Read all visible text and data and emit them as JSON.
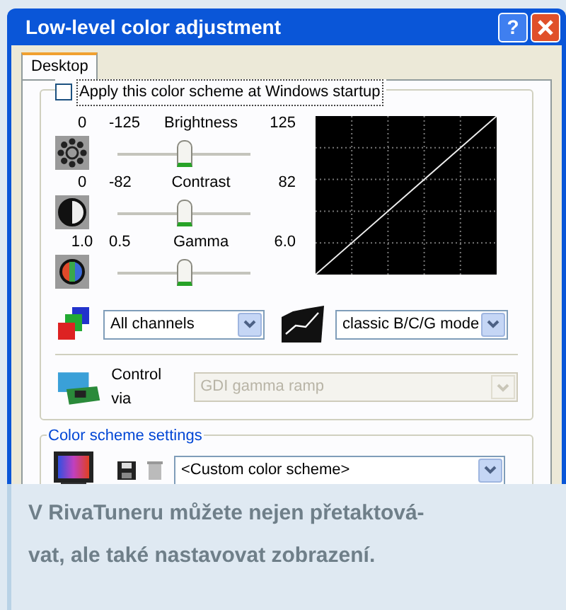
{
  "window": {
    "title": "Low-level color adjustment",
    "help": "?"
  },
  "tabs": [
    {
      "label": "Desktop",
      "selected": true
    }
  ],
  "startup_checkbox": {
    "label": "Apply this color scheme at Windows startup",
    "checked": false
  },
  "sliders": [
    {
      "kind": "brightness",
      "value": "0",
      "min": "-125",
      "name": "Brightness",
      "max": "125",
      "level": 0.5
    },
    {
      "kind": "contrast",
      "value": "0",
      "min": "-82",
      "name": "Contrast",
      "max": "82",
      "level": 0.5
    },
    {
      "kind": "gamma",
      "value": "1.0",
      "min": "0.5",
      "name": "Gamma",
      "max": "6.0",
      "level": 0.5
    }
  ],
  "channel_select": {
    "value": "All channels"
  },
  "mode_select": {
    "value": "classic B/C/G mode"
  },
  "control_via": {
    "label": "Control via",
    "value": "GDI gamma ramp",
    "disabled": true
  },
  "color_scheme": {
    "title": "Color scheme settings",
    "value": "<Custom color scheme>"
  },
  "caption": [
    "V RivaTuneru můžete nejen přetaktová-",
    "vat, ale také nastavovat zobrazení."
  ]
}
